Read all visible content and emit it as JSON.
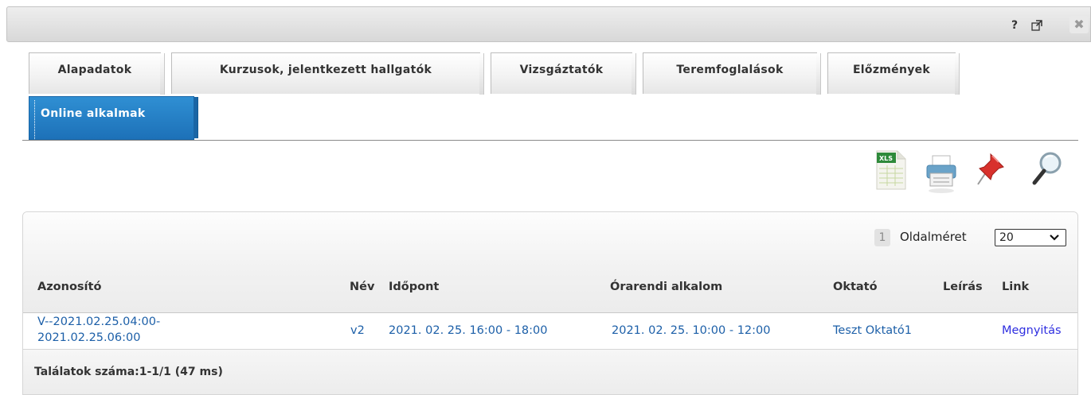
{
  "titlebar": {
    "help": "?",
    "popout": "⇗",
    "close": "✖"
  },
  "tabs": [
    {
      "label": "Alapadatok",
      "active": false
    },
    {
      "label": "Kurzusok, jelentkezett hallgatók",
      "active": false
    },
    {
      "label": "Vizsgáztatók",
      "active": false
    },
    {
      "label": "Teremfoglalások",
      "active": false
    },
    {
      "label": "Előzmények",
      "active": false
    },
    {
      "label": "Online alkalmak",
      "active": true
    }
  ],
  "toolbar": {
    "excel_badge": "XLS",
    "icons": [
      "excel-export-icon",
      "print-icon",
      "pin-icon",
      "search-icon"
    ]
  },
  "pager": {
    "page": "1",
    "label": "Oldalméret",
    "page_size": "20"
  },
  "table": {
    "headers": [
      "Azonosító",
      "Név",
      "Időpont",
      "Órarendi alkalom",
      "Oktató",
      "Leírás",
      "Link"
    ],
    "rows": [
      {
        "id_line1": "V--2021.02.25.04:00-",
        "id_line2": "2021.02.25.06:00",
        "name": "v2",
        "time": "2021. 02. 25. 16:00 - 18:00",
        "schedule": "2021. 02. 25. 10:00 - 12:00",
        "teacher": "Teszt Oktató1",
        "description": "",
        "link": "Megnyitás"
      }
    ]
  },
  "footer": {
    "results": "Találatok száma:1-1/1 (47 ms)"
  },
  "colors": {
    "active_tab": "#1d71b8",
    "link": "#1c5fa8",
    "open_link": "#2f2fe0"
  }
}
